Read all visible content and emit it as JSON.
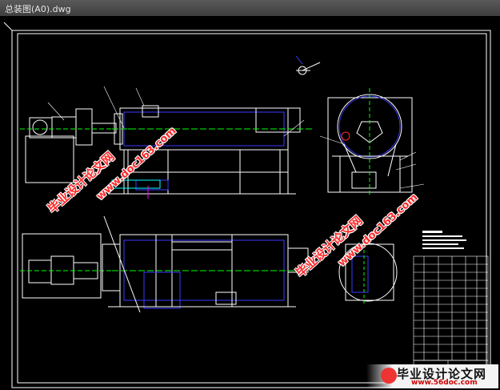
{
  "window": {
    "title": "总装图(A0).dwg"
  },
  "watermarks": [
    {
      "text": "毕业设计论文网",
      "url": "www.doc163.com"
    }
  ],
  "brand": {
    "name": "毕业设计论文网",
    "url": "www.56doc.com"
  },
  "colors": {
    "background": "#000000",
    "frame": "#ffffff",
    "part_outline": "#ffffff",
    "blue": "#3a3aff",
    "green": "#00ff00",
    "cyan": "#00ffff",
    "red": "#ff2a2a",
    "magenta": "#ff00ff"
  }
}
